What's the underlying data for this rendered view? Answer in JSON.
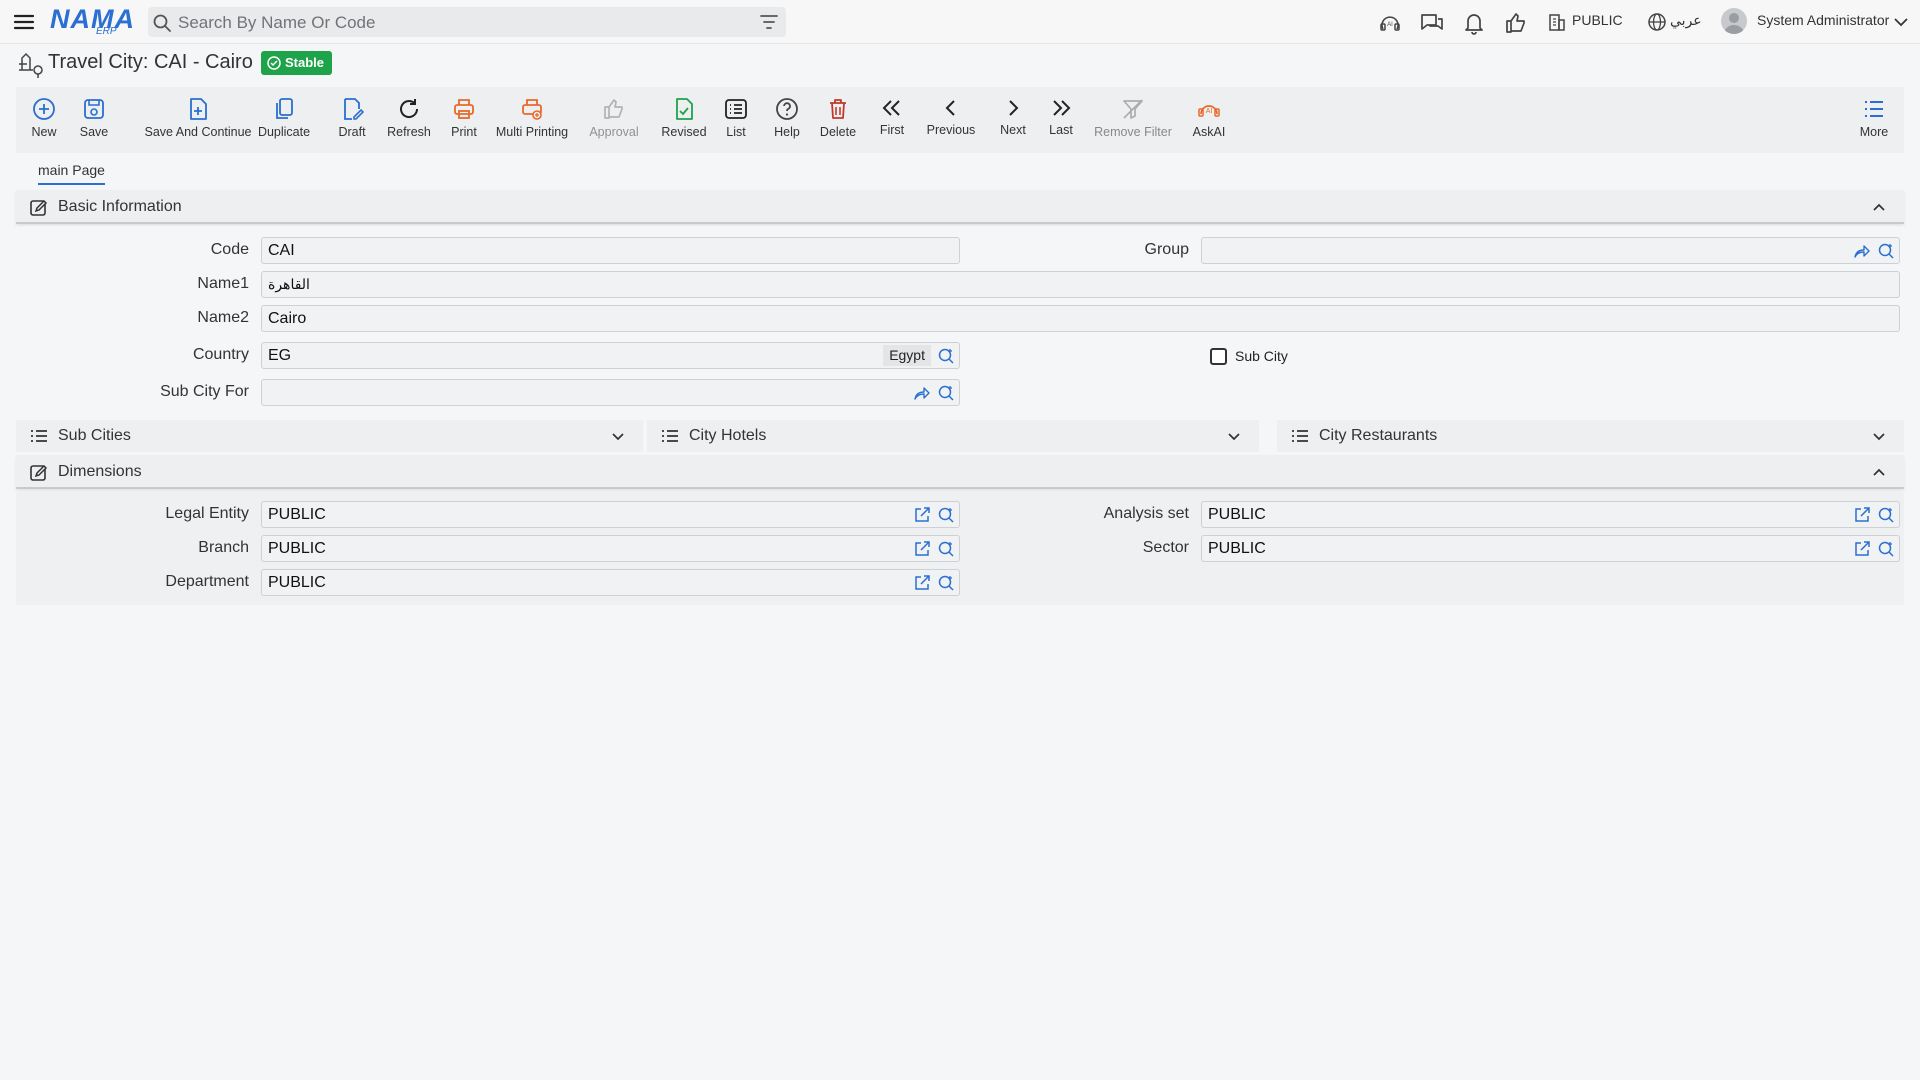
{
  "header": {
    "logo_text": "NAMA",
    "logo_sub": "ERP",
    "search_placeholder": "Search By Name Or Code",
    "company": "PUBLIC",
    "language": "عربي",
    "user": "System Administrator"
  },
  "page": {
    "title": "Travel City: CAI - Cairo",
    "status": "Stable"
  },
  "toolbar": {
    "new": "New",
    "save": "Save",
    "save_continue": "Save And Continue",
    "duplicate": "Duplicate",
    "draft": "Draft",
    "refresh": "Refresh",
    "print": "Print",
    "multi_printing": "Multi Printing",
    "approval": "Approval",
    "revised": "Revised",
    "list": "List",
    "help": "Help",
    "delete": "Delete",
    "first": "First",
    "previous": "Previous",
    "next": "Next",
    "last": "Last",
    "remove_filter": "Remove Filter",
    "askai": "AskAI",
    "more": "More"
  },
  "tabs": {
    "main": "main Page"
  },
  "basic_info": {
    "title": "Basic Information",
    "code_label": "Code",
    "code_value": "CAI",
    "group_label": "Group",
    "group_value": "",
    "name1_label": "Name1",
    "name1_value": "القاهرة",
    "name2_label": "Name2",
    "name2_value": "Cairo",
    "country_label": "Country",
    "country_value": "EG",
    "country_name": "Egypt",
    "sub_city_label": "Sub City",
    "sub_city_for_label": "Sub City For",
    "sub_city_for_value": ""
  },
  "grids": {
    "sub_cities": "Sub Cities",
    "city_hotels": "City Hotels",
    "city_restaurants": "City Restaurants"
  },
  "dimensions": {
    "title": "Dimensions",
    "legal_entity_label": "Legal Entity",
    "legal_entity_value": "PUBLIC",
    "analysis_set_label": "Analysis set",
    "analysis_set_value": "PUBLIC",
    "branch_label": "Branch",
    "branch_value": "PUBLIC",
    "sector_label": "Sector",
    "sector_value": "PUBLIC",
    "department_label": "Department",
    "department_value": "PUBLIC"
  },
  "colors": {
    "accent": "#2a6fd1",
    "status_green": "#1fa34a",
    "print_orange": "#e8692c",
    "delete_red": "#c0392b"
  }
}
